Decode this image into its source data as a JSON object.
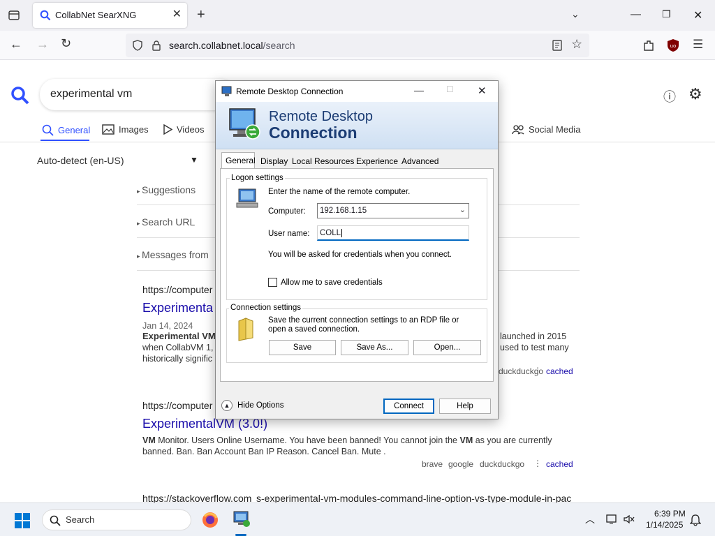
{
  "browser": {
    "tab_title": "CollabNet SearXNG",
    "url_domain": "search.collabnet.local",
    "url_path": "/search"
  },
  "search": {
    "query": "experimental vm",
    "categories": [
      "General",
      "Images",
      "Videos",
      "Social Media"
    ],
    "language": "Auto-detect (en-US)",
    "sidebar": [
      "Suggestions",
      "Search URL",
      "Messages from"
    ]
  },
  "results": [
    {
      "url": "https://computer",
      "title": "Experimenta",
      "date": "Jan 14, 2024",
      "snippet_bold": "Experimental VM",
      "snippet_right1": "launched in 2015",
      "snippet_line2_left": "when CollabVM 1,",
      "snippet_line2_right": "used to test many",
      "snippet_line3": "historically signific",
      "engines": "duckduckgo",
      "cached": "cached"
    },
    {
      "url": "https://computer",
      "title": "ExperimentalVM (3.0!)",
      "snippet_line1": "Monitor. Users Online Username. You have been banned! You cannot join the",
      "snippet_vm": "VM",
      "snippet_line1_end": "as you are currently",
      "snippet_line2": "banned. Ban. Ban Account Ban IP Reason. Cancel Ban. Mute .",
      "engines": [
        "brave",
        "google",
        "duckduckgo"
      ],
      "cached": "cached"
    },
    {
      "url_left": "https://stackoverflow.com",
      "url_right": "s-experimental-vm-modules-command-line-option-vs-type-module-in-pac"
    }
  ],
  "rdp": {
    "title": "Remote Desktop Connection",
    "banner_line1": "Remote Desktop",
    "banner_line2": "Connection",
    "tabs": [
      "General",
      "Display",
      "Local Resources",
      "Experience",
      "Advanced"
    ],
    "logon_group": "Logon settings",
    "logon_hint": "Enter the name of the remote computer.",
    "computer_label": "Computer:",
    "computer_value": "192.168.1.15",
    "username_label": "User name:",
    "username_value": "COLL",
    "credentials_note": "You will be asked for credentials when you connect.",
    "save_credentials": "Allow me to save credentials",
    "connection_group": "Connection settings",
    "connection_hint": "Save the current connection settings to an RDP file or open a saved connection.",
    "save_label": "Save",
    "save_as_label": "Save As...",
    "open_label": "Open...",
    "hide_options": "Hide Options",
    "connect_label": "Connect",
    "help_label": "Help"
  },
  "taskbar": {
    "search_label": "Search",
    "time": "6:39 PM",
    "date": "1/14/2025"
  },
  "colors": {
    "accent": "#3050ff",
    "link": "#1a0dab",
    "rdp_title": "#1c3d74"
  }
}
